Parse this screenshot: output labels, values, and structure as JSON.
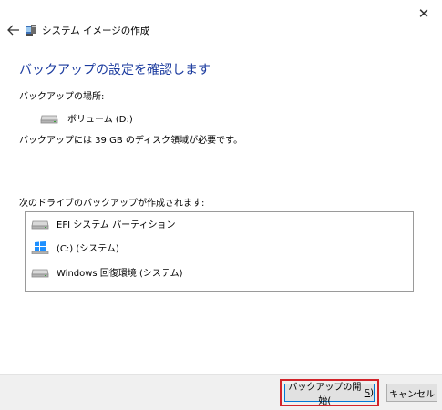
{
  "window": {
    "title": "システム イメージの作成",
    "close_glyph": "✕"
  },
  "page": {
    "heading": "バックアップの設定を確認します",
    "location_label": "バックアップの場所:",
    "location_drive": "ボリューム (D:)",
    "space_text": "バックアップには 39 GB のディスク領域が必要です。",
    "drives_label": "次のドライブのバックアップが作成されます:",
    "drives": [
      {
        "name": "EFI システム パーティション",
        "icon": "drive-icon"
      },
      {
        "name": "(C:) (システム)",
        "icon": "windows-drive-icon"
      },
      {
        "name": "Windows 回復環境 (システム)",
        "icon": "drive-icon"
      }
    ]
  },
  "footer": {
    "start_label_prefix": "バックアップの開始(",
    "start_label_key": "S",
    "start_label_suffix": ")",
    "cancel_label": "キャンセル"
  },
  "colors": {
    "heading": "#1a3a9e",
    "highlight": "#d2232a",
    "footer_bg": "#f0f0f0",
    "button_bg": "#e1e1e1"
  }
}
